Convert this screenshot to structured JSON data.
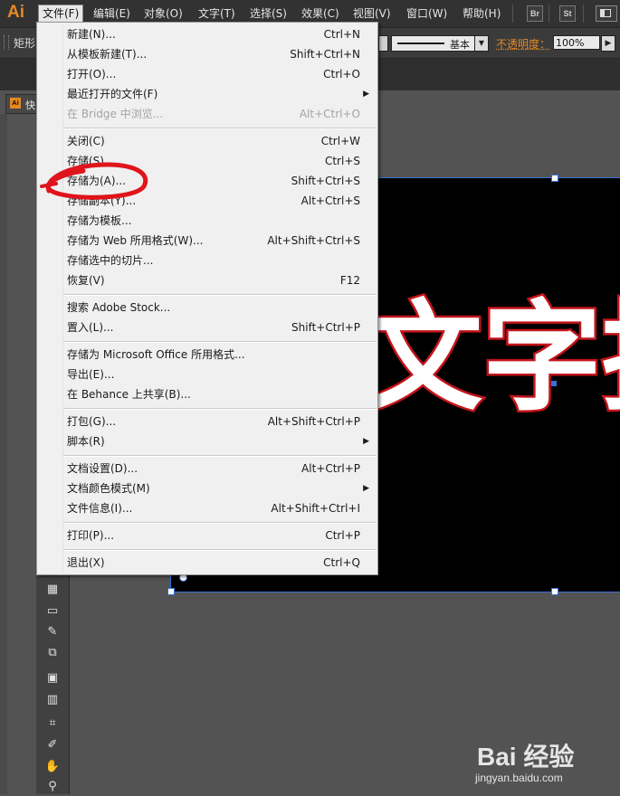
{
  "menubar": {
    "logo": "Ai",
    "items": [
      "文件(F)",
      "编辑(E)",
      "对象(O)",
      "文字(T)",
      "选择(S)",
      "效果(C)",
      "视图(V)",
      "窗口(W)",
      "帮助(H)"
    ],
    "bridge_button": "Br",
    "stock_button": "St"
  },
  "controlbar": {
    "shape_label": "矩形",
    "stroke_style": "基本",
    "opacity_label": "不透明度：",
    "opacity_value": "100%"
  },
  "document_tab": {
    "label": "快"
  },
  "artboard": {
    "text": "文字描"
  },
  "file_menu": {
    "items": [
      {
        "label": "新建(N)...",
        "shortcut": "Ctrl+N"
      },
      {
        "label": "从模板新建(T)...",
        "shortcut": "Shift+Ctrl+N"
      },
      {
        "label": "打开(O)...",
        "shortcut": "Ctrl+O"
      },
      {
        "label": "最近打开的文件(F)",
        "shortcut": ""
      },
      {
        "label": "在 Bridge 中浏览...",
        "shortcut": "Alt+Ctrl+O"
      },
      {
        "label": "关闭(C)",
        "shortcut": "Ctrl+W"
      },
      {
        "label": "存储(S)",
        "shortcut": "Ctrl+S"
      },
      {
        "label": "存储为(A)...",
        "shortcut": "Shift+Ctrl+S"
      },
      {
        "label": "存储副本(Y)...",
        "shortcut": "Alt+Ctrl+S"
      },
      {
        "label": "存储为模板...",
        "shortcut": ""
      },
      {
        "label": "存储为 Web 所用格式(W)...",
        "shortcut": "Alt+Shift+Ctrl+S"
      },
      {
        "label": "存储选中的切片...",
        "shortcut": ""
      },
      {
        "label": "恢复(V)",
        "shortcut": "F12"
      },
      {
        "label": "搜索 Adobe Stock...",
        "shortcut": ""
      },
      {
        "label": "置入(L)...",
        "shortcut": "Shift+Ctrl+P"
      },
      {
        "label": "存储为 Microsoft Office 所用格式...",
        "shortcut": ""
      },
      {
        "label": "导出(E)...",
        "shortcut": ""
      },
      {
        "label": "在 Behance 上共享(B)...",
        "shortcut": ""
      },
      {
        "label": "打包(G)...",
        "shortcut": "Alt+Shift+Ctrl+P"
      },
      {
        "label": "脚本(R)",
        "shortcut": ""
      },
      {
        "label": "文档设置(D)...",
        "shortcut": "Alt+Ctrl+P"
      },
      {
        "label": "文档颜色模式(M)",
        "shortcut": ""
      },
      {
        "label": "文件信息(I)...",
        "shortcut": "Alt+Shift+Ctrl+I"
      },
      {
        "label": "打印(P)...",
        "shortcut": "Ctrl+P"
      },
      {
        "label": "退出(X)",
        "shortcut": "Ctrl+Q"
      }
    ]
  },
  "watermark": {
    "brand": "Bai 经验",
    "url": "jingyan.baidu.com"
  },
  "colors": {
    "accent": "#e48a25",
    "selection": "#3a6fd8",
    "annotation": "#e0141c",
    "stroke": "#c3141b"
  }
}
